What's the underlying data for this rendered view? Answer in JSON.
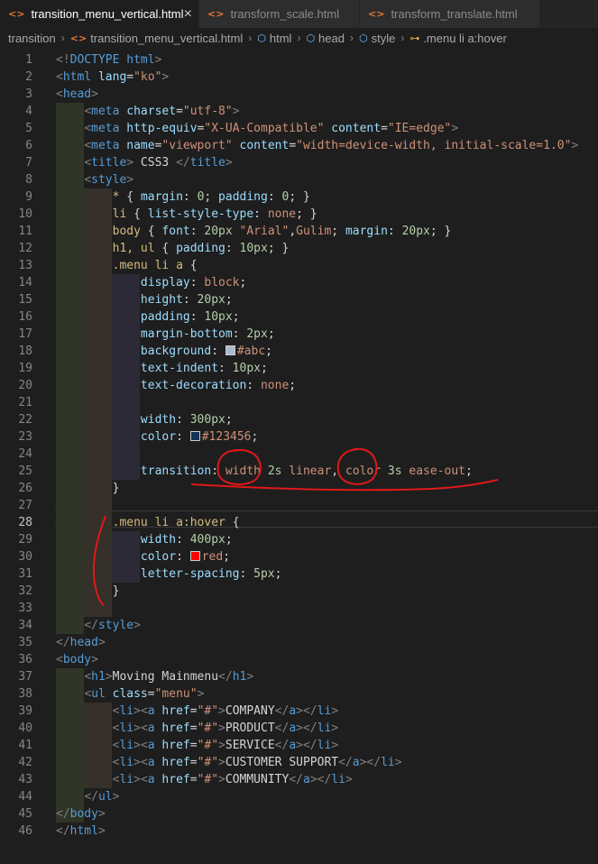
{
  "tabs": [
    {
      "label": "transition_menu_vertical.html",
      "close": "×"
    },
    {
      "label": "transform_scale.html"
    },
    {
      "label": "transform_translate.html"
    }
  ],
  "tab_icon": "<>",
  "breadcrumb": [
    "transition",
    "transition_menu_vertical.html",
    "html",
    "head",
    "style",
    ".menu li a:hover"
  ],
  "icons": {
    "tab": "html-file-icon",
    "breadcrumb_file": "html-file-icon",
    "breadcrumb_element": "cube-icon",
    "breadcrumb_selector": "css-selector-icon",
    "separator": "chevron-right-icon"
  },
  "lines": [
    "<!DOCTYPE html>",
    "<html lang=\"ko\">",
    "<head>",
    "    <meta charset=\"utf-8\">",
    "    <meta http-equiv=\"X-UA-Compatible\" content=\"IE=edge\">",
    "    <meta name=\"viewport\" content=\"width=device-width, initial-scale=1.0\">",
    "    <title> CSS3 </title>",
    "    <style>",
    "        * { margin: 0; padding: 0; }",
    "        li { list-style-type: none; }",
    "        body { font: 20px \"Arial\",Gulim; margin: 20px; }",
    "        h1, ul { padding: 10px; }",
    "        .menu li a {",
    "            display: block;",
    "            height: 20px;",
    "            padding: 10px;",
    "            margin-bottom: 2px;",
    "            background: #abc;",
    "            text-indent: 10px;",
    "            text-decoration: none;",
    "",
    "            width: 300px;",
    "            color: #123456;",
    "",
    "            transition: width 2s linear, color 3s ease-out;",
    "        }",
    "",
    "        .menu li a:hover {",
    "            width: 400px;",
    "            color: red;",
    "            letter-spacing: 5px;",
    "        }",
    "",
    "    </style>",
    "</head>",
    "<body>",
    "    <h1>Moving Mainmenu</h1>",
    "    <ul class=\"menu\">",
    "        <li><a href=\"#\">COMPANY</a></li>",
    "        <li><a href=\"#\">PRODUCT</a></li>",
    "        <li><a href=\"#\">SERVICE</a></li>",
    "        <li><a href=\"#\">CUSTOMER SUPPORT</a></li>",
    "        <li><a href=\"#\">COMMUNITY</a></li>",
    "    </ul>",
    "</body>",
    "</html>"
  ],
  "current_line": 28,
  "colors": {
    "background": "#1e1e1e",
    "tag": "#569cd6",
    "attribute": "#9cdcfe",
    "string": "#ce9178",
    "selector": "#d7ba7d",
    "number": "#b5cea8",
    "annotation": "#e0181b",
    "swatch_abc": "#aabbcc",
    "swatch_123456": "#123456",
    "swatch_red": "#ff0000"
  }
}
